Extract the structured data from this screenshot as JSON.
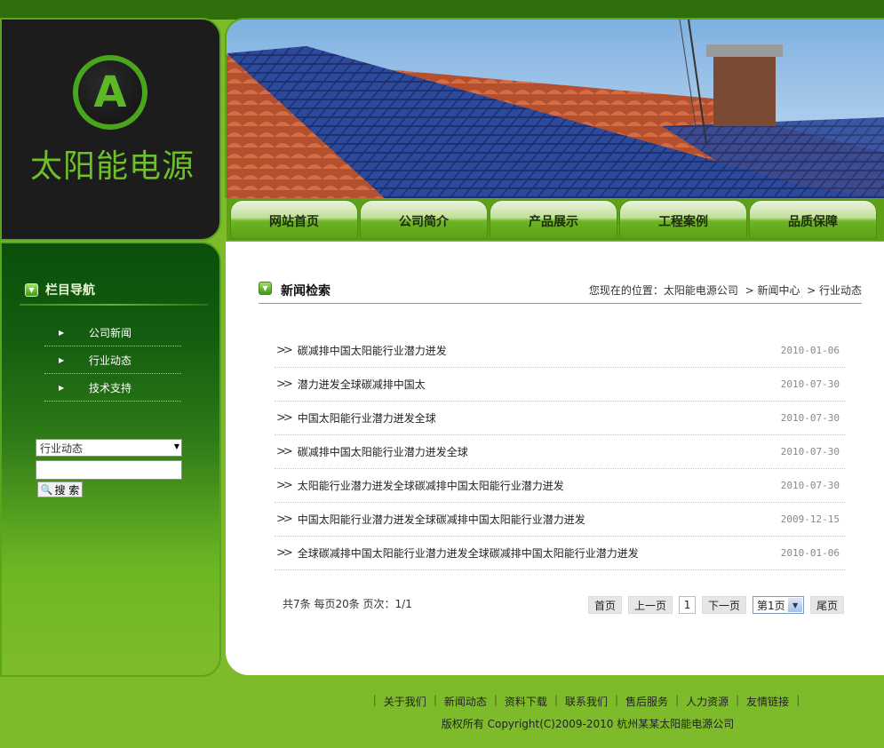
{
  "logo": {
    "letter": "A",
    "text": "太阳能电源"
  },
  "nav": [
    "网站首页",
    "公司简介",
    "产品展示",
    "工程案例",
    "品质保障"
  ],
  "sidebar": {
    "title": "栏目导航",
    "items": [
      "公司新闻",
      "行业动态",
      "技术支持"
    ],
    "search": {
      "category": "行业动态",
      "input_value": "",
      "button": "搜 索"
    }
  },
  "main": {
    "title": "新闻检索",
    "breadcrumb": {
      "prefix": "您现在的位置：",
      "items": [
        "太阳能电源公司",
        "新闻中心",
        "行业动态"
      ]
    },
    "news": [
      {
        "title": "碳减排中国太阳能行业潜力迸发",
        "date": "2010-01-06"
      },
      {
        "title": "潜力迸发全球碳减排中国太",
        "date": "2010-07-30"
      },
      {
        "title": "中国太阳能行业潜力迸发全球",
        "date": "2010-07-30"
      },
      {
        "title": "碳减排中国太阳能行业潜力迸发全球",
        "date": "2010-07-30"
      },
      {
        "title": "太阳能行业潜力迸发全球碳减排中国太阳能行业潜力迸发",
        "date": "2010-07-30"
      },
      {
        "title": "中国太阳能行业潜力迸发全球碳减排中国太阳能行业潜力迸发",
        "date": "2009-12-15"
      },
      {
        "title": "全球碳减排中国太阳能行业潜力迸发全球碳减排中国太阳能行业潜力迸发",
        "date": "2010-01-06"
      }
    ],
    "pager": {
      "info": "共7条 每页20条 页次：1/1",
      "first": "首页",
      "prev": "上一页",
      "current": "1",
      "next": "下一页",
      "page_select": "第1页",
      "last": "尾页"
    }
  },
  "footer": {
    "links": [
      "关于我们",
      "新闻动态",
      "资料下载",
      "联系我们",
      "售后服务",
      "人力资源",
      "友情链接"
    ],
    "copyright": "版权所有  Copyright(C)2009-2010 杭州某某太阳能电源公司"
  }
}
